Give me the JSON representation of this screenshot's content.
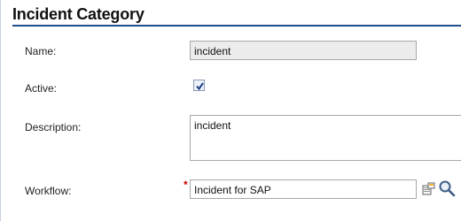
{
  "header": {
    "title": "Incident Category"
  },
  "form": {
    "name": {
      "label": "Name:",
      "value": "incident"
    },
    "active": {
      "label": "Active:",
      "checked": true
    },
    "description": {
      "label": "Description:",
      "value": "incident"
    },
    "workflow": {
      "label": "Workflow:",
      "value": "Incident for SAP",
      "required_marker": "*"
    }
  },
  "icons": {
    "lookup": "lookup-icon",
    "search": "magnifier-icon"
  },
  "colors": {
    "header_rule": "#1f4e8c",
    "required": "#cc0000"
  }
}
